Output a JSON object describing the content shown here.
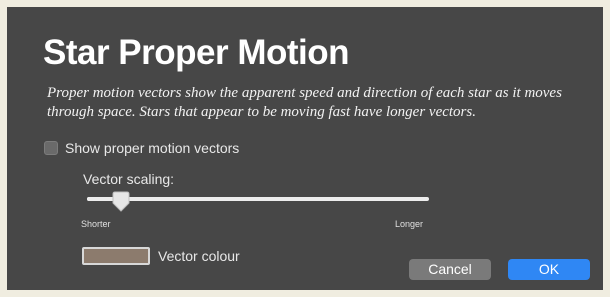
{
  "dialog": {
    "title": "Star Proper Motion",
    "description": "Proper motion vectors show the apparent speed and direction of each star as it moves through space. Stars that appear to be moving fast have longer vectors."
  },
  "checkbox": {
    "label": "Show proper motion vectors",
    "checked": false
  },
  "slider": {
    "label": "Vector scaling:",
    "min_label": "Shorter",
    "max_label": "Longer",
    "value": 0.1
  },
  "colour": {
    "label": "Vector colour",
    "value": "#8c7b6d"
  },
  "buttons": {
    "cancel": "Cancel",
    "ok": "OK"
  }
}
